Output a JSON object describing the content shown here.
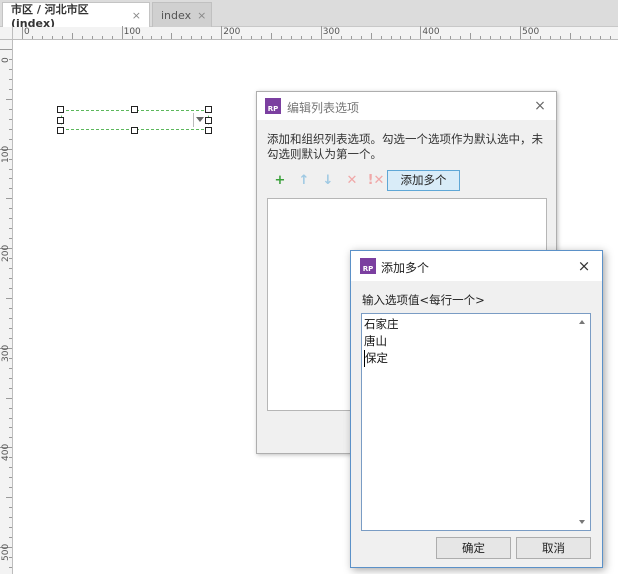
{
  "tabs": [
    {
      "label": "市区 / 河北市区 (index)",
      "close": "×",
      "active": true
    },
    {
      "label": "index",
      "close": "×",
      "active": false
    }
  ],
  "ruler": {
    "top_labels": [
      "0",
      "100",
      "200",
      "300",
      "400",
      "500"
    ],
    "left_labels": [
      "0",
      "100",
      "200",
      "300",
      "400",
      "500"
    ]
  },
  "canvas": {
    "widget": "dropdown-list",
    "selected_value": ""
  },
  "edit_dialog": {
    "icon_text": "RP",
    "title": "编辑列表选项",
    "close": "×",
    "description": "添加和组织列表选项。勾选一个选项作为默认选中，未勾选则默认为第一个。",
    "toolbar": {
      "add": "+",
      "move_up": "↑",
      "move_down": "↓",
      "delete": "✕",
      "delete_all": "!✕",
      "add_multiple": "添加多个"
    }
  },
  "add_multi_dialog": {
    "icon_text": "RP",
    "title": "添加多个",
    "close": "×",
    "input_label": "输入选项值<每行一个>",
    "lines": [
      "石家庄",
      "唐山",
      "保定"
    ],
    "ok": "确定",
    "cancel": "取消"
  },
  "colors": {
    "rp_icon": "#7b3fa0",
    "add_green": "#3aa03a",
    "selection_dashed": "#5cb85c",
    "primary_button_bg": "#d9ecf8"
  }
}
